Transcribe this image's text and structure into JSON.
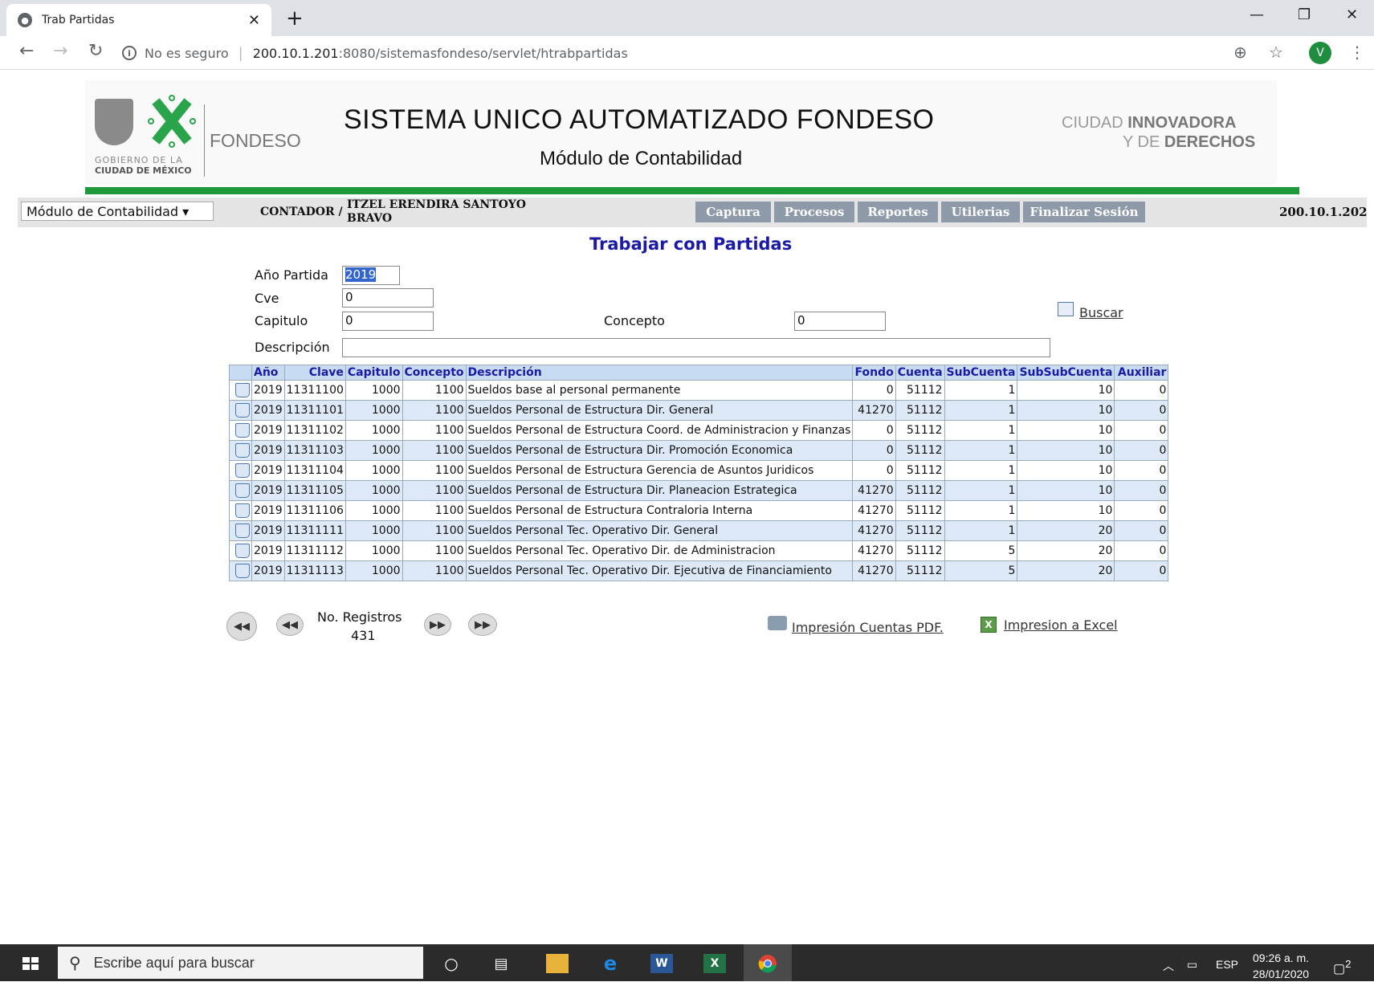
{
  "browser": {
    "tab_title": "Trab Partidas",
    "security_label": "No es seguro",
    "url_host": "200.10.1.201",
    "url_path": ":8080/sistemasfondeso/servlet/htrabpartidas",
    "profile_initial": "V"
  },
  "header": {
    "gob_line1": "GOBIERNO DE LA",
    "gob_line2": "CIUDAD DE MÉXICO",
    "org": "FONDESO",
    "system_title": "SISTEMA UNICO AUTOMATIZADO FONDESO",
    "module_subtitle": "Módulo de Contabilidad",
    "slogan_a1": "CIUDAD ",
    "slogan_a2": "INNOVADORA",
    "slogan_b1": "Y DE ",
    "slogan_b2": "DERECHOS"
  },
  "menubar": {
    "module_select": "Módulo de Contabilidad ▾",
    "role": "CONTADOR /",
    "user": "ITZEL ERENDIRA SANTOYO BRAVO",
    "items": [
      "Captura",
      "Procesos",
      "Reportes",
      "Utilerias",
      "Finalizar Sesión"
    ],
    "ip": "200.10.1.202"
  },
  "form": {
    "heading": "Trabajar con Partidas",
    "anio_label": "Año Partida",
    "anio_value": "2019",
    "cve_label": "Cve",
    "cve_value": "0",
    "capitulo_label": "Capitulo",
    "capitulo_value": "0",
    "concepto_label": "Concepto",
    "concepto_value": "0",
    "descripcion_label": "Descripción",
    "descripcion_value": "",
    "buscar": "Buscar"
  },
  "table": {
    "headers": [
      "Año",
      "Clave",
      "Capitulo",
      "Concepto",
      "Descripción",
      "Fondo",
      "Cuenta",
      "SubCuenta",
      "SubSubCuenta",
      "Auxiliar"
    ],
    "rows": [
      [
        "2019",
        "11311100",
        "1000",
        "1100",
        "Sueldos base al personal permanente",
        "0",
        "51112",
        "1",
        "10",
        "0"
      ],
      [
        "2019",
        "11311101",
        "1000",
        "1100",
        "Sueldos Personal de Estructura Dir. General",
        "41270",
        "51112",
        "1",
        "10",
        "0"
      ],
      [
        "2019",
        "11311102",
        "1000",
        "1100",
        "Sueldos Personal de Estructura Coord. de Administracion y Finanzas",
        "0",
        "51112",
        "1",
        "10",
        "0"
      ],
      [
        "2019",
        "11311103",
        "1000",
        "1100",
        "Sueldos Personal de Estructura Dir. Promoción Economica",
        "0",
        "51112",
        "1",
        "10",
        "0"
      ],
      [
        "2019",
        "11311104",
        "1000",
        "1100",
        "Sueldos Personal de Estructura Gerencia de Asuntos Juridicos",
        "0",
        "51112",
        "1",
        "10",
        "0"
      ],
      [
        "2019",
        "11311105",
        "1000",
        "1100",
        "Sueldos Personal de Estructura Dir. Planeacion Estrategica",
        "41270",
        "51112",
        "1",
        "10",
        "0"
      ],
      [
        "2019",
        "11311106",
        "1000",
        "1100",
        "Sueldos Personal de Estructura Contraloria Interna",
        "41270",
        "51112",
        "1",
        "10",
        "0"
      ],
      [
        "2019",
        "11311111",
        "1000",
        "1100",
        "Sueldos Personal Tec. Operativo Dir. General",
        "41270",
        "51112",
        "1",
        "20",
        "0"
      ],
      [
        "2019",
        "11311112",
        "1000",
        "1100",
        "Sueldos Personal Tec. Operativo Dir. de Administracion",
        "41270",
        "51112",
        "5",
        "20",
        "0"
      ],
      [
        "2019",
        "11311113",
        "1000",
        "1100",
        "Sueldos Personal Tec. Operativo Dir. Ejecutiva de Financiamiento",
        "41270",
        "51112",
        "5",
        "20",
        "0"
      ]
    ]
  },
  "pager": {
    "registros_label": "No. Registros",
    "registros_value": "431",
    "pdf_link": "Impresión Cuentas PDF.",
    "excel_link": "Impresion a Excel"
  },
  "taskbar": {
    "search_placeholder": "Escribe aquí para buscar",
    "lang": "ESP",
    "time": "09:26 a. m.",
    "date": "28/01/2020",
    "notif_count": "2"
  }
}
